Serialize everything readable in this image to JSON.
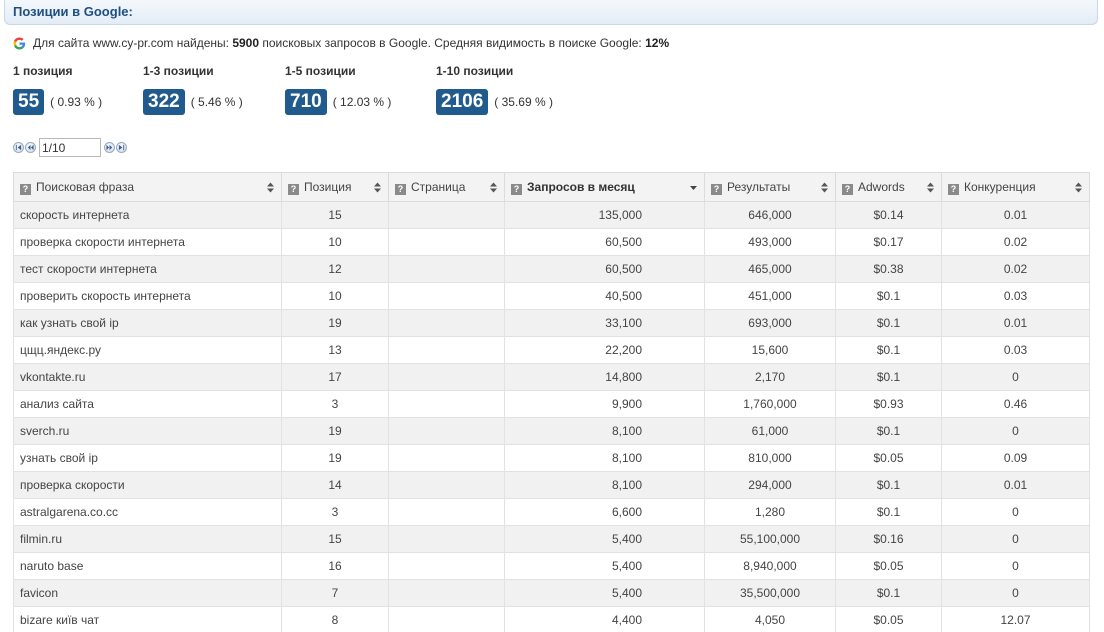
{
  "header": {
    "title": "Позиции в Google:"
  },
  "summary": {
    "text_before": "Для сайта www.cy-pr.com найдены: ",
    "query_count": "5900",
    "text_middle": " поисковых запросов в Google. Средняя видимость в поиске Google: ",
    "visibility": "12%",
    "icon": "google-icon"
  },
  "positions": [
    {
      "label": "1 позиция",
      "count": "55",
      "percent": "( 0.93 % )"
    },
    {
      "label": "1-3 позиции",
      "count": "322",
      "percent": "( 5.46 % )"
    },
    {
      "label": "1-5 позиции",
      "count": "710",
      "percent": "( 12.03 % )"
    },
    {
      "label": "1-10 позиции",
      "count": "2106",
      "percent": "( 35.69 % )"
    }
  ],
  "pager": {
    "value": "1/10"
  },
  "table": {
    "columns": [
      {
        "label": "Поисковая фраза",
        "sort": "both"
      },
      {
        "label": "Позиция",
        "sort": "both"
      },
      {
        "label": "Страница",
        "sort": "both"
      },
      {
        "label": "Запросов в месяц",
        "sort": "desc"
      },
      {
        "label": "Результаты",
        "sort": "both"
      },
      {
        "label": "Adwords",
        "sort": "both"
      },
      {
        "label": "Конкуренция",
        "sort": "both"
      }
    ],
    "rows": [
      [
        "скорость интернета",
        "15",
        "",
        "135,000",
        "646,000",
        "$0.14",
        "0.01"
      ],
      [
        "проверка скорости интернета",
        "10",
        "",
        "60,500",
        "493,000",
        "$0.17",
        "0.02"
      ],
      [
        "тест скорости интернета",
        "12",
        "",
        "60,500",
        "465,000",
        "$0.38",
        "0.02"
      ],
      [
        "проверить скорость интернета",
        "10",
        "",
        "40,500",
        "451,000",
        "$0.1",
        "0.03"
      ],
      [
        "как узнать свой ip",
        "19",
        "",
        "33,100",
        "693,000",
        "$0.1",
        "0.01"
      ],
      [
        "цщц.яндекс.ру",
        "13",
        "",
        "22,200",
        "15,600",
        "$0.1",
        "0.03"
      ],
      [
        "vkontakte.ru",
        "17",
        "",
        "14,800",
        "2,170",
        "$0.1",
        "0"
      ],
      [
        "анализ сайта",
        "3",
        "",
        "9,900",
        "1,760,000",
        "$0.93",
        "0.46"
      ],
      [
        "sverch.ru",
        "19",
        "",
        "8,100",
        "61,000",
        "$0.1",
        "0"
      ],
      [
        "узнать свой ip",
        "19",
        "",
        "8,100",
        "810,000",
        "$0.05",
        "0.09"
      ],
      [
        "проверка скорости",
        "14",
        "",
        "8,100",
        "294,000",
        "$0.1",
        "0.01"
      ],
      [
        "astralgarena.co.cc",
        "3",
        "",
        "6,600",
        "1,280",
        "$0.1",
        "0"
      ],
      [
        "filmin.ru",
        "15",
        "",
        "5,400",
        "55,100,000",
        "$0.16",
        "0"
      ],
      [
        "naruto base",
        "16",
        "",
        "5,400",
        "8,940,000",
        "$0.05",
        "0"
      ],
      [
        "favicon",
        "7",
        "",
        "5,400",
        "35,500,000",
        "$0.1",
        "0"
      ],
      [
        "bizare київ чат",
        "8",
        "",
        "4,400",
        "4,050",
        "$0.05",
        "12.07"
      ]
    ]
  },
  "colors": {
    "accent": "#215b8e",
    "title": "#1f4f80"
  }
}
